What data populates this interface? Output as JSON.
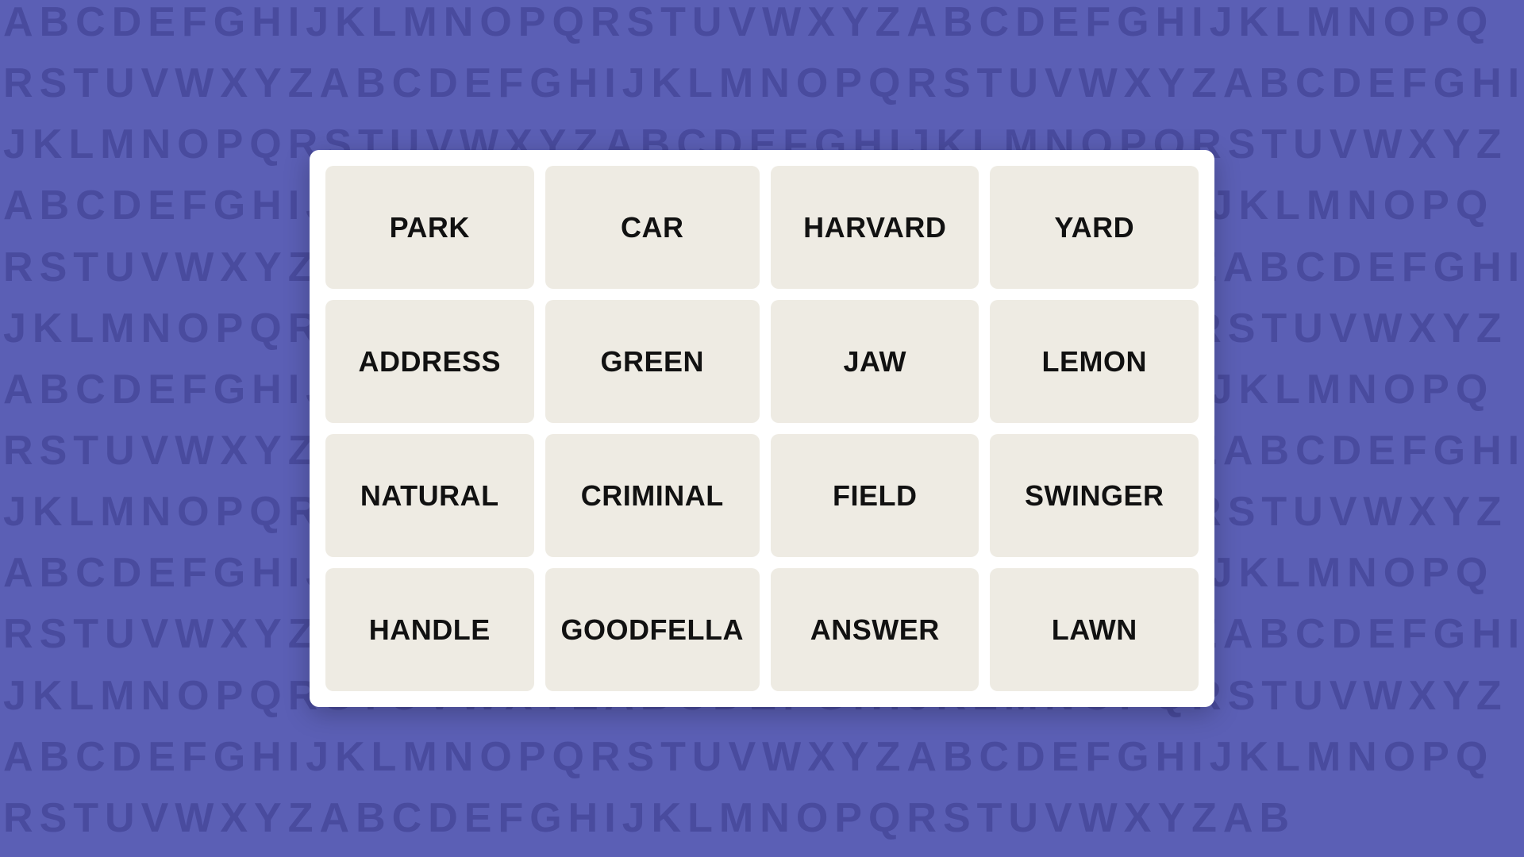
{
  "background": {
    "color": "#5b5fb5",
    "letters": "ABCDEFGHIJKLMNOPQRSTUVWXYZ"
  },
  "grid": {
    "cells": [
      {
        "id": "park",
        "label": "PARK"
      },
      {
        "id": "car",
        "label": "CAR"
      },
      {
        "id": "harvard",
        "label": "HARVARD"
      },
      {
        "id": "yard",
        "label": "YARD"
      },
      {
        "id": "address",
        "label": "ADDRESS"
      },
      {
        "id": "green",
        "label": "GREEN"
      },
      {
        "id": "jaw",
        "label": "JAW"
      },
      {
        "id": "lemon",
        "label": "LEMON"
      },
      {
        "id": "natural",
        "label": "NATURAL"
      },
      {
        "id": "criminal",
        "label": "CRIMINAL"
      },
      {
        "id": "field",
        "label": "FIELD"
      },
      {
        "id": "swinger",
        "label": "SWINGER"
      },
      {
        "id": "handle",
        "label": "HANDLE"
      },
      {
        "id": "goodfella",
        "label": "GOODFELLA"
      },
      {
        "id": "answer",
        "label": "ANSWER"
      },
      {
        "id": "lawn",
        "label": "LAWN"
      }
    ]
  }
}
